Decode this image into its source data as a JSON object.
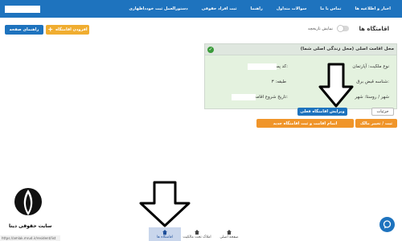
{
  "nav": {
    "items": [
      "اخبار و اطلاعیه ها",
      "تماس با ما",
      "سوالات متداول",
      "راهنما",
      "ثبت افراد حقوقی",
      "دستورالعمل ثبت خودداظهاری"
    ]
  },
  "page": {
    "title": "اقامتگاه ها",
    "history_toggle_label": "نمایش تاریخچه",
    "add_button": "افزودن اقامتگاه",
    "help_button": "راهنمای صفحه"
  },
  "card": {
    "title": "محل اقامت اصلی (محل زندگی اصلی شما)",
    "ownership_label": "نوع ملکیت: آپارتمان",
    "postal_label": "کد پستی:",
    "building_label": "شناسه قبض برق:",
    "floor_label": "طبقه: ۳",
    "city_label": "شهر / روستا: شهر",
    "start_date_label": "تاریخ شروع اقامت:",
    "edit_button": "ویرایش اقامتگاه فعلی",
    "details_button": "جزئیات",
    "end_button": "اتمام اقامت و ثبت اقامتگاه جدید",
    "change_owner_button": "ثبت / تغییر مالک"
  },
  "bottom_nav": [
    {
      "label": "صفحه اصلی",
      "icon": "home-icon",
      "active": false
    },
    {
      "label": "املاک تحت مالکیت",
      "icon": "home-icon",
      "active": false
    },
    {
      "label": "اقامتگاه ها",
      "icon": "home-icon",
      "active": true
    }
  ],
  "brand": {
    "text": "سایت حقوقی دینا"
  },
  "status_url": "https://amlak.mrud.ir/resident/list",
  "colors": {
    "primary": "#1e73be",
    "orange": "#f0952a",
    "card_bg": "#e4f2df",
    "success": "#3a9a3a"
  }
}
